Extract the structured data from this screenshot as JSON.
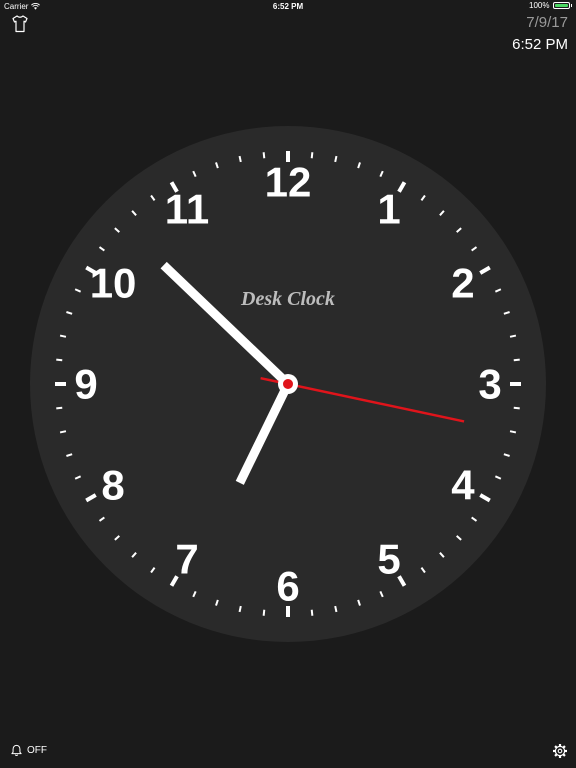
{
  "status_bar": {
    "carrier": "Carrier",
    "time": "6:52 PM",
    "battery": "100%",
    "battery_level": 1.0
  },
  "header": {
    "theme_icon": "tshirt-icon",
    "date": "7/9/17",
    "time": "6:52 PM"
  },
  "clock": {
    "brand": "Desk Clock",
    "numerals": [
      "12",
      "1",
      "2",
      "3",
      "4",
      "5",
      "6",
      "7",
      "8",
      "9",
      "10",
      "11"
    ],
    "hour": 6,
    "minute": 52,
    "second": 17,
    "colors": {
      "face": "#2a2a2a",
      "hands": "#ffffff",
      "second_hand": "#e0141b"
    }
  },
  "footer": {
    "alarm_icon": "bell-icon",
    "alarm_state": "OFF",
    "settings_icon": "gear-icon"
  }
}
